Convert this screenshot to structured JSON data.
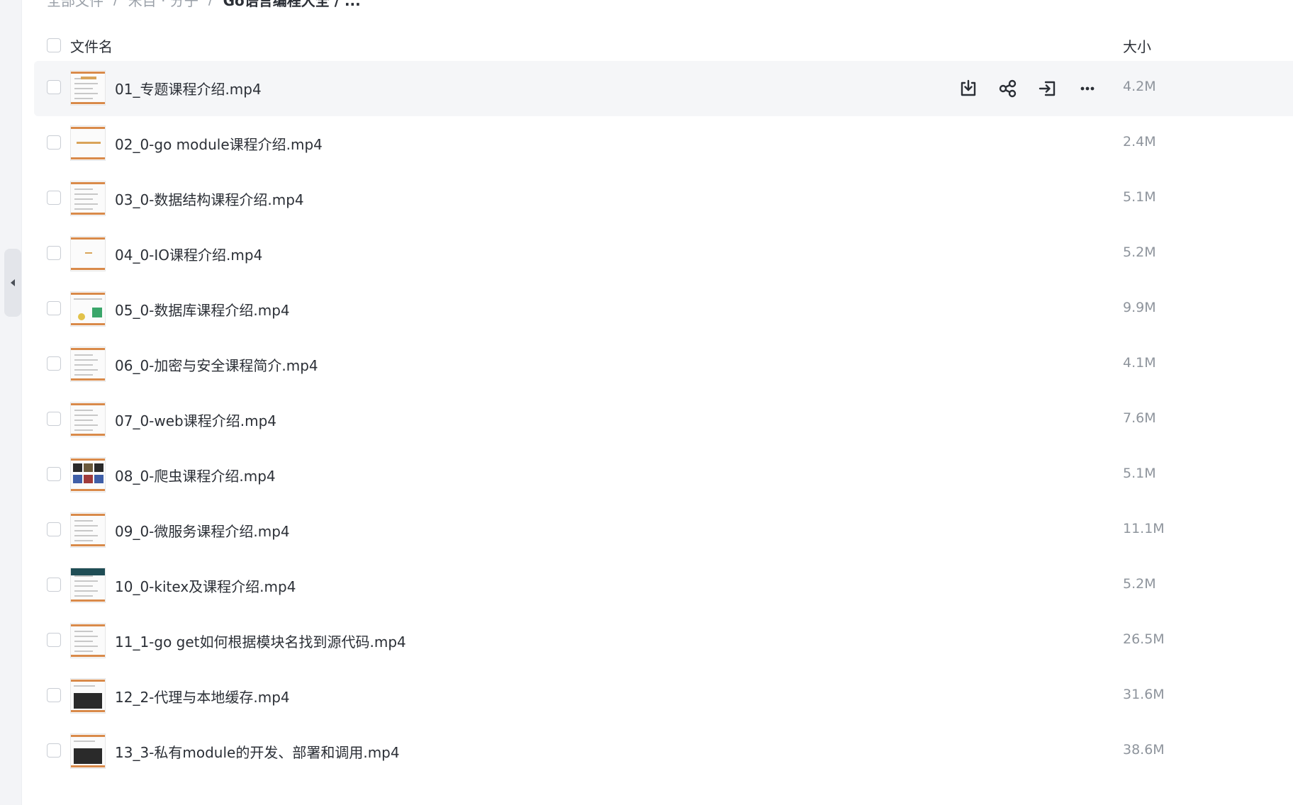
{
  "breadcrumb": {
    "items": [
      "全部文件",
      "宋目 · 分子",
      "Go语言编程大全 / ..."
    ],
    "separator": "/"
  },
  "header": {
    "name_label": "文件名",
    "size_label": "大小"
  },
  "files": [
    {
      "name": "01_专题课程介绍.mp4",
      "size": "4.2M"
    },
    {
      "name": "02_0-go module课程介绍.mp4",
      "size": "2.4M"
    },
    {
      "name": "03_0-数据结构课程介绍.mp4",
      "size": "5.1M"
    },
    {
      "name": "04_0-IO课程介绍.mp4",
      "size": "5.2M"
    },
    {
      "name": "05_0-数据库课程介绍.mp4",
      "size": "9.9M"
    },
    {
      "name": "06_0-加密与安全课程简介.mp4",
      "size": "4.1M"
    },
    {
      "name": "07_0-web课程介绍.mp4",
      "size": "7.6M"
    },
    {
      "name": "08_0-爬虫课程介绍.mp4",
      "size": "5.1M"
    },
    {
      "name": "09_0-微服务课程介绍.mp4",
      "size": "11.1M"
    },
    {
      "name": "10_0-kitex及课程介绍.mp4",
      "size": "5.2M"
    },
    {
      "name": "11_1-go get如何根据模块名找到源代码.mp4",
      "size": "26.5M"
    },
    {
      "name": "12_2-代理与本地缓存.mp4",
      "size": "31.6M"
    },
    {
      "name": "13_3-私有module的开发、部署和调用.mp4",
      "size": "38.6M"
    }
  ],
  "row_actions": [
    {
      "icon": "download-icon"
    },
    {
      "icon": "share-icon"
    },
    {
      "icon": "move-icon"
    },
    {
      "icon": "more-icon"
    }
  ],
  "colors": {
    "hover_row": "#f5f6f8",
    "thumb_accent": "#d98a4a",
    "text_primary": "#2b2f36",
    "text_secondary": "#8e949c"
  }
}
